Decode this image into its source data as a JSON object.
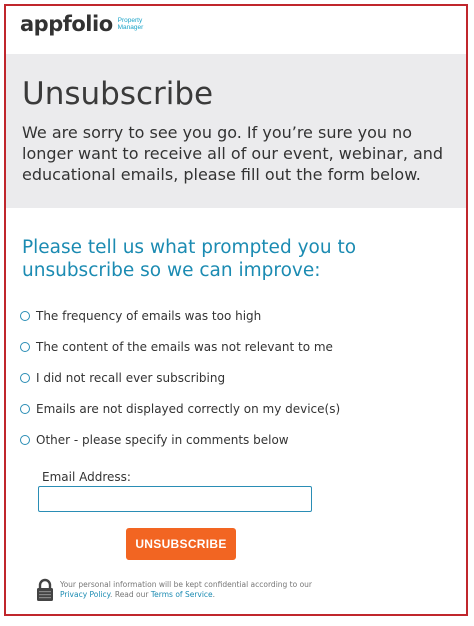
{
  "brand": {
    "name": "appfolio",
    "tagline_line1": "Property",
    "tagline_line2": "Manager"
  },
  "banner": {
    "title": "Unsubscribe",
    "intro": "We are sorry to see you go. If you’re sure you no longer want to receive all of our event, webinar, and educational emails, please fill out the form below."
  },
  "form": {
    "question": "Please tell us what prompted you to unsubscribe so we can improve:",
    "options": [
      "The frequency of emails was too high",
      "The content of the emails was not relevant to me",
      "I did not recall ever subscribing",
      "Emails are not displayed correctly on my device(s)",
      "Other - please specify in comments below"
    ],
    "email_label": "Email Address:",
    "email_value": "",
    "submit_label": "UNSUBSCRIBE"
  },
  "footer": {
    "privacy_prefix": "Your personal information will be kept confidential according to our ",
    "privacy_link": "Privacy Policy",
    "privacy_middle": ". Read our ",
    "terms_link": "Terms of Service",
    "privacy_suffix": "."
  },
  "colors": {
    "frame_border": "#c0262c",
    "banner_bg": "#ebebed",
    "accent_blue": "#1b8bb2",
    "button_orange": "#f26522"
  },
  "icons": {
    "lock": "lock-icon"
  }
}
